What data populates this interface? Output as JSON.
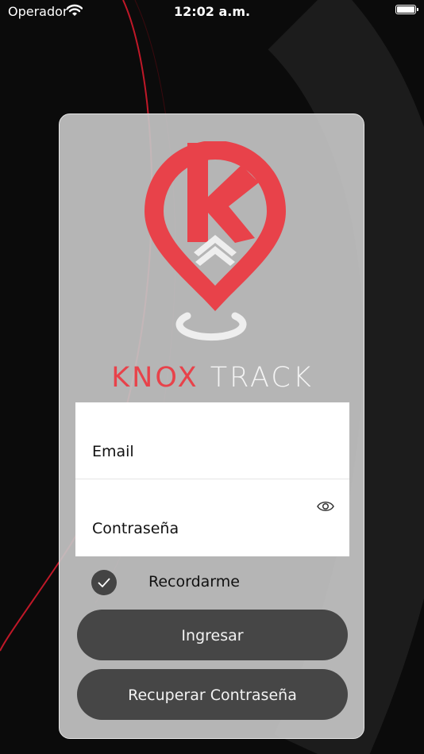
{
  "status_bar": {
    "carrier": "Operador",
    "time": "12:02 a.m."
  },
  "brand": {
    "part1": "KNOX",
    "part2": "TRACK"
  },
  "login": {
    "email_placeholder": "Email",
    "password_placeholder": "Contraseña",
    "remember_label": "Recordarme",
    "remember_checked": true,
    "login_button": "Ingresar",
    "recover_button": "Recuperar Contraseña"
  },
  "colors": {
    "brand_red": "#e8424a",
    "button_bg": "#464646",
    "card_bg": "#c4c4c4"
  },
  "icons": {
    "wifi": "wifi-icon",
    "battery": "battery-icon",
    "eye": "eye-icon",
    "check": "checkmark-icon"
  }
}
